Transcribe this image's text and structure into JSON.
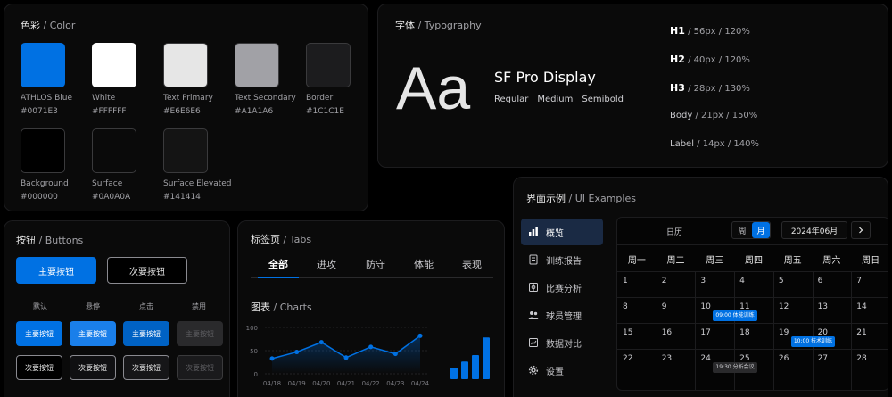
{
  "color": {
    "title": "色彩",
    "title_en": "/ Color",
    "swatches": [
      {
        "name": "ATHLOS Blue",
        "hex": "#0071E3"
      },
      {
        "name": "White",
        "hex": "#FFFFFF"
      },
      {
        "name": "Text Primary",
        "hex": "#E6E6E6"
      },
      {
        "name": "Text Secondary",
        "hex": "#A1A1A6"
      },
      {
        "name": "Border",
        "hex": "#1C1C1E"
      },
      {
        "name": "Background",
        "hex": "#000000"
      },
      {
        "name": "Surface",
        "hex": "#0A0A0A"
      },
      {
        "name": "Surface Elevated",
        "hex": "#141414"
      }
    ]
  },
  "typography": {
    "title": "字体",
    "title_en": "/ Typography",
    "sample": "Aa",
    "font_name": "SF Pro Display",
    "weights": [
      "Regular",
      "Medium",
      "Semibold"
    ],
    "scale": [
      {
        "name": "H1",
        "spec": "/ 56px / 120%"
      },
      {
        "name": "H2",
        "spec": "/ 40px / 120%"
      },
      {
        "name": "H3",
        "spec": "/ 28px / 130%"
      },
      {
        "name": "Body",
        "spec": "/ 21px / 150%"
      },
      {
        "name": "Label",
        "spec": "/ 14px / 140%"
      }
    ]
  },
  "buttons": {
    "title": "按钮",
    "title_en": "/ Buttons",
    "primary_label": "主要按钮",
    "secondary_label": "次要按钮",
    "states": [
      "默认",
      "悬停",
      "点击",
      "禁用"
    ]
  },
  "tabs": {
    "title": "标签页",
    "title_en": "/ Tabs",
    "items": [
      "全部",
      "进攻",
      "防守",
      "体能",
      "表现"
    ],
    "active_index": 0
  },
  "charts": {
    "title": "图表",
    "title_en": "/ Charts"
  },
  "chart_data": [
    {
      "type": "line",
      "x": [
        "04/18",
        "04/19",
        "04/20",
        "04/21",
        "04/22",
        "04/23",
        "04/24"
      ],
      "series": [
        {
          "values": [
            33,
            47,
            68,
            35,
            58,
            43,
            82
          ]
        }
      ],
      "yticks": [
        0,
        50,
        100
      ],
      "ylim": [
        0,
        100
      ],
      "grid": true,
      "area_fill": true,
      "color": "#0071E3"
    },
    {
      "type": "bar",
      "values": [
        25,
        38,
        52,
        90
      ],
      "color": "#0071E3"
    }
  ],
  "ui": {
    "title": "界面示例",
    "title_en": "/ UI Examples",
    "sidebar": [
      {
        "label": "概览",
        "icon": "chart-icon",
        "active": true
      },
      {
        "label": "训练报告",
        "icon": "report-icon",
        "active": false
      },
      {
        "label": "比赛分析",
        "icon": "analysis-icon",
        "active": false
      },
      {
        "label": "球员管理",
        "icon": "users-icon",
        "active": false
      },
      {
        "label": "数据对比",
        "icon": "compare-icon",
        "active": false
      },
      {
        "label": "设置",
        "icon": "gear-icon",
        "active": false
      }
    ],
    "calendar": {
      "title": "日历",
      "view_week": "周",
      "view_month": "月",
      "month": "2024年06月",
      "weekdays": [
        "周一",
        "周二",
        "周三",
        "周四",
        "周五",
        "周六",
        "周日"
      ],
      "rows": [
        [
          1,
          2,
          3,
          4,
          5,
          6,
          7
        ],
        [
          8,
          9,
          10,
          11,
          12,
          13,
          14
        ],
        [
          15,
          16,
          17,
          18,
          19,
          20,
          21
        ],
        [
          22,
          23,
          24,
          25,
          26,
          27,
          28
        ]
      ],
      "events": [
        {
          "text": "09:00 体能训练",
          "row": 1,
          "col": 2,
          "style": "blue"
        },
        {
          "text": "10:00 技术训练",
          "row": 2,
          "col": 4,
          "style": "blue"
        },
        {
          "text": "19:30 分析会议",
          "row": 3,
          "col": 2,
          "style": "gray"
        }
      ]
    }
  }
}
